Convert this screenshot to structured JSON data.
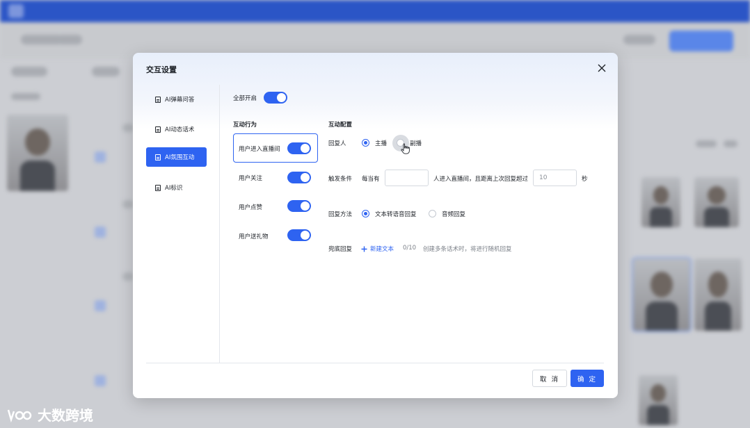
{
  "watermark": {
    "text": "大数跨境"
  },
  "modal": {
    "title": "交互设置",
    "sidebar": {
      "items": [
        {
          "label": "AI弹幕问答",
          "active": false
        },
        {
          "label": "AI动态话术",
          "active": false
        },
        {
          "label": "AI氛围互动",
          "active": true
        },
        {
          "label": "AI标识",
          "active": false
        }
      ]
    },
    "all_on": {
      "label": "全部开启",
      "on": true
    },
    "behavior": {
      "heading": "互动行为",
      "items": [
        {
          "label": "用户进入直播间",
          "on": true,
          "selected": true
        },
        {
          "label": "用户关注",
          "on": true
        },
        {
          "label": "用户点赞",
          "on": true
        },
        {
          "label": "用户送礼物",
          "on": true
        }
      ]
    },
    "config": {
      "heading": "互动配置",
      "responder": {
        "label": "回复人",
        "options": [
          {
            "label": "主播",
            "checked": true
          },
          {
            "label": "副播",
            "checked": false
          }
        ]
      },
      "trigger": {
        "label": "触发条件",
        "prefix": "每当有",
        "count_value": "",
        "middle": "人进入直播间，且距离上次回复超过",
        "seconds_value": "10",
        "suffix": "秒"
      },
      "reply_method": {
        "label": "回复方法",
        "options": [
          {
            "label": "文本转语音回复",
            "checked": true
          },
          {
            "label": "音频回复",
            "checked": false
          }
        ]
      },
      "fallback": {
        "label": "兜底回复",
        "add_label": "新建文本",
        "count": "0/10",
        "hint": "创建多条话术时，将进行随机回复"
      }
    },
    "footer": {
      "cancel_label": "取 消",
      "ok_label": "确 定"
    }
  },
  "colors": {
    "accent": "#2e63f1",
    "topbar": "#2b55c6"
  }
}
